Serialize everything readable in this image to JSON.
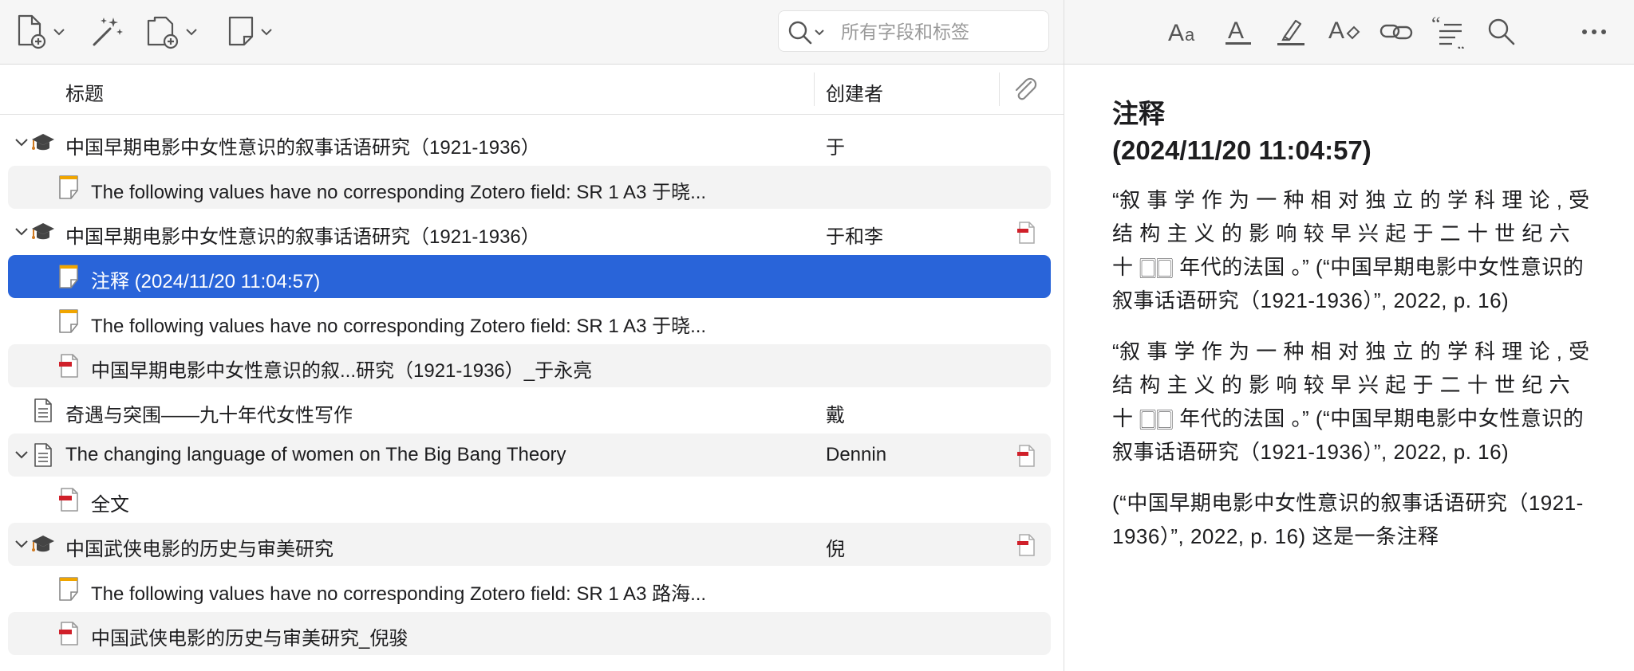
{
  "toolbar": {
    "search": {
      "placeholder": "所有字段和标签",
      "value": ""
    }
  },
  "columns": {
    "title": "标题",
    "creator": "创建者"
  },
  "items": [
    {
      "title": "中国早期电影中女性意识的叙事话语研究（1921-1936）",
      "creator": "于",
      "icon": "thesis-icon",
      "expandable": true,
      "level": 0,
      "attachment": false
    },
    {
      "title": "The following values have no corresponding Zotero field: SR 1 A3 于晓...",
      "creator": "",
      "icon": "note-icon",
      "expandable": false,
      "level": 1,
      "attachment": false
    },
    {
      "title": "中国早期电影中女性意识的叙事话语研究（1921-1936）",
      "creator": "于和李",
      "icon": "thesis-icon",
      "expandable": true,
      "level": 0,
      "attachment": true
    },
    {
      "title": "注释 (2024/11/20 11:04:57)",
      "creator": "",
      "icon": "note-icon",
      "expandable": false,
      "level": 1,
      "attachment": false,
      "selected": true
    },
    {
      "title": "The following values have no corresponding Zotero field: SR 1 A3 于晓...",
      "creator": "",
      "icon": "note-icon",
      "expandable": false,
      "level": 1,
      "attachment": false
    },
    {
      "title": "中国早期电影中女性意识的叙...研究（1921-1936）_于永亮",
      "creator": "",
      "icon": "pdf-icon",
      "expandable": false,
      "level": 1,
      "attachment": false
    },
    {
      "title": "奇遇与突围——九十年代女性写作",
      "creator": "戴",
      "icon": "document-icon",
      "expandable": false,
      "level": 0,
      "attachment": false
    },
    {
      "title": "The changing language of women on The Big Bang Theory",
      "creator": "Dennin",
      "icon": "document-icon",
      "expandable": true,
      "level": 0,
      "attachment": true
    },
    {
      "title": "全文",
      "creator": "",
      "icon": "pdf-icon",
      "expandable": false,
      "level": 1,
      "attachment": false
    },
    {
      "title": "中国武侠电影的历史与审美研究",
      "creator": "倪",
      "icon": "thesis-icon",
      "expandable": true,
      "level": 0,
      "attachment": true
    },
    {
      "title": "The following values have no corresponding Zotero field: SR 1 A3 路海...",
      "creator": "",
      "icon": "note-icon",
      "expandable": false,
      "level": 1,
      "attachment": false
    },
    {
      "title": "中国武侠电影的历史与审美研究_倪骏",
      "creator": "",
      "icon": "pdf-icon",
      "expandable": false,
      "level": 1,
      "attachment": false
    }
  ],
  "note": {
    "heading_line1": "注释",
    "heading_line2": "(2024/11/20 11:04:57)",
    "paragraphs": [
      "“叙 事 学 作 为 一 种 相 对 独 立 的 学 科 理 论 , 受 结 构 主 义 的 影 响 较 早 兴 起 于 二 十 世 纪 六 十 🀆🀆 年代的法国 。” (“中国早期电影中女性意识的叙事话语研究（1921-1936）”, 2022, p. 16)",
      "“叙 事 学 作 为 一 种 相 对 独 立 的 学 科 理 论 , 受 结 构 主 义 的 影 响 较 早 兴 起 于 二 十 世 纪 六 十 🀆🀆 年代的法国 。” (“中国早期电影中女性意识的叙事话语研究（1921-1936）”, 2022, p. 16)",
      "(“中国早期电影中女性意识的叙事话语研究（1921-1936）”, 2022, p. 16) 这是一条注释"
    ]
  },
  "colors": {
    "selection": "#2964d9",
    "note_icon": "#f0a500",
    "pdf_icon": "#d0202a",
    "toolbar_bg": "#f6f6f6"
  }
}
